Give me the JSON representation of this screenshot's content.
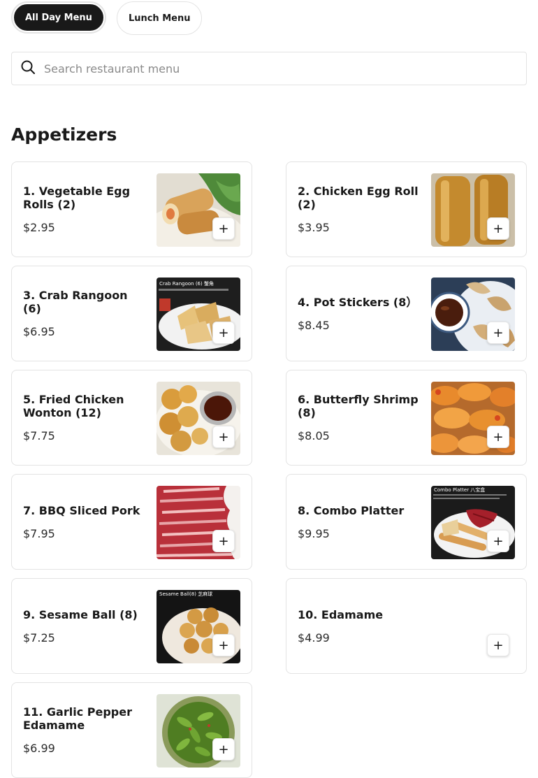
{
  "tabs": [
    {
      "label": "All Day Menu",
      "active": true
    },
    {
      "label": "Lunch Menu",
      "active": false
    }
  ],
  "search": {
    "placeholder": "Search restaurant menu",
    "icon": "search-icon"
  },
  "section": {
    "title": "Appetizers"
  },
  "items": [
    {
      "name": "1. Vegetable Egg Rolls (2)",
      "price": "$2.95",
      "has_image": true,
      "image_caption": ""
    },
    {
      "name": "2. Chicken Egg Roll (2)",
      "price": "$3.95",
      "has_image": true,
      "image_caption": ""
    },
    {
      "name": "3. Crab Rangoon (6)",
      "price": "$6.95",
      "has_image": true,
      "image_caption": "Crab Rangoon (6) 蟹角"
    },
    {
      "name": "4. Pot Stickers (8）",
      "price": "$8.45",
      "has_image": true,
      "image_caption": ""
    },
    {
      "name": "5. Fried Chicken Wonton (12)",
      "price": "$7.75",
      "has_image": true,
      "image_caption": ""
    },
    {
      "name": "6. Butterfly Shrimp (8)",
      "price": "$8.05",
      "has_image": true,
      "image_caption": ""
    },
    {
      "name": "7. BBQ Sliced Pork",
      "price": "$7.95",
      "has_image": true,
      "image_caption": ""
    },
    {
      "name": "8. Combo Platter",
      "price": "$9.95",
      "has_image": true,
      "image_caption": "Combo Platter 八宝盒"
    },
    {
      "name": "9. Sesame Ball (8)",
      "price": "$7.25",
      "has_image": true,
      "image_caption": "Sesame Ball(8) 芝麻球"
    },
    {
      "name": "10. Edamame",
      "price": "$4.99",
      "has_image": false,
      "image_caption": ""
    },
    {
      "name": "11. Garlic Pepper Edamame",
      "price": "$6.99",
      "has_image": true,
      "image_caption": ""
    }
  ],
  "add_button_label": "+"
}
